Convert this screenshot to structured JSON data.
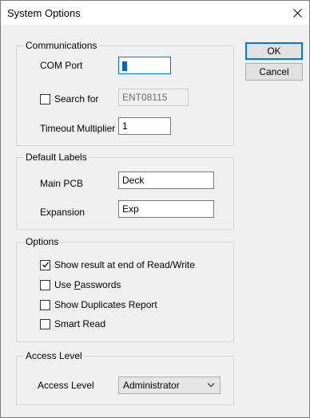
{
  "title": "System Options",
  "buttons": {
    "ok": "OK",
    "cancel": "Cancel"
  },
  "communications": {
    "heading": "Communications",
    "com_port_label": "COM Port",
    "com_port_value": "1",
    "search_for_label": "Search for",
    "search_for_checked": false,
    "search_for_value": "ENT08115",
    "timeout_label": "Timeout Multiplier",
    "timeout_value": "1"
  },
  "default_labels": {
    "heading": "Default Labels",
    "main_pcb_label": "Main PCB",
    "main_pcb_value": "Deck",
    "expansion_label": "Expansion",
    "expansion_value": "Exp"
  },
  "options": {
    "heading": "Options",
    "items": [
      {
        "label_pre": "Show result at end of Read/Write",
        "checked": true
      },
      {
        "label_pre": "Use ",
        "mnemonic": "P",
        "label_post": "asswords",
        "checked": false
      },
      {
        "label_pre": "Show Duplicates Report",
        "checked": false
      },
      {
        "label_pre": "Smart Read",
        "checked": false
      }
    ]
  },
  "access": {
    "heading": "Access Level",
    "label": "Access Level",
    "selected": "Administrator"
  },
  "icons": {
    "close": "close-icon",
    "check": "check-icon",
    "dropdown": "chevron-down-icon"
  }
}
